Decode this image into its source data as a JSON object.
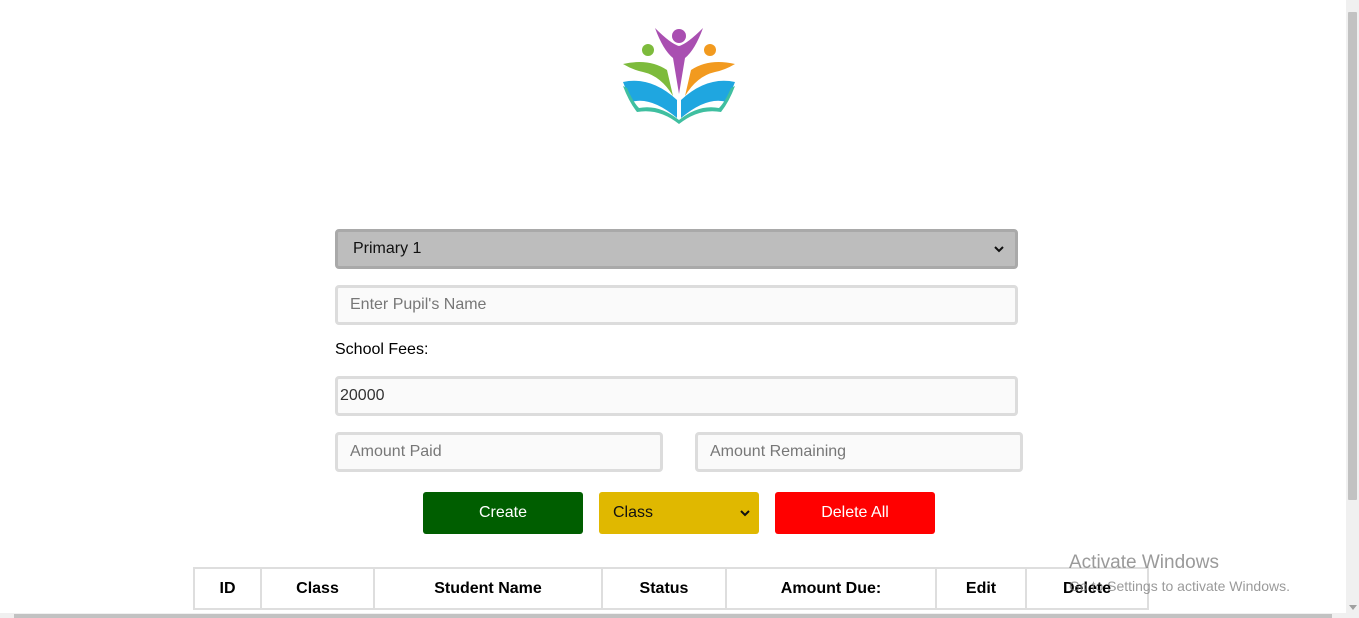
{
  "form": {
    "class_select_value": "Primary 1",
    "pupil_name_placeholder": "Enter Pupil's Name",
    "school_fees_label": "School Fees:",
    "school_fees_value": "20000",
    "amount_paid_placeholder": "Amount Paid",
    "amount_remaining_placeholder": "Amount Remaining"
  },
  "actions": {
    "create_label": "Create",
    "class_filter_value": "Class",
    "delete_all_label": "Delete All"
  },
  "table": {
    "headers": [
      "ID",
      "Class",
      "Student Name",
      "Status",
      "Amount Due:",
      "Edit",
      "Delete"
    ]
  },
  "watermark": {
    "title": "Activate Windows",
    "subtitle": "Go to Settings to activate Windows."
  },
  "colors": {
    "create_button": "#005e00",
    "class_filter": "#e0b800",
    "delete_button": "#ff0000",
    "class_select_bg": "#bdbdbd"
  },
  "icons": {
    "logo": "education-book-people-logo",
    "dropdown": "chevron-down-icon"
  }
}
